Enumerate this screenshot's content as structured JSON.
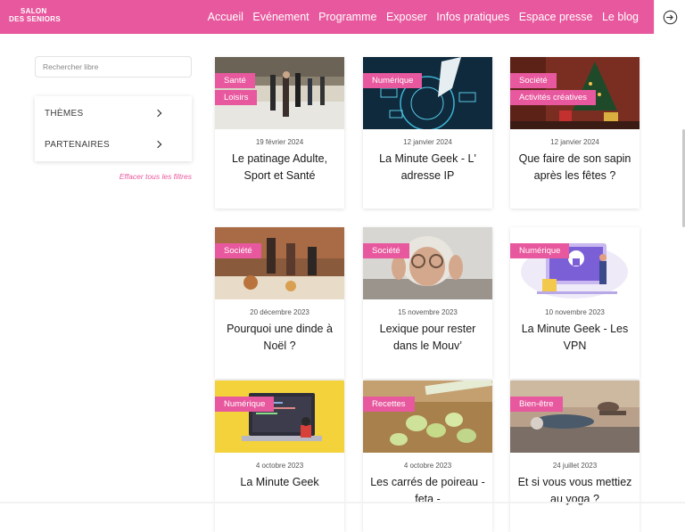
{
  "header": {
    "logo_line1": "SALON",
    "logo_line2": "DES SENIORS",
    "nav": [
      "Accueil",
      "Evénement",
      "Programme",
      "Exposer",
      "Infos pratiques",
      "Espace presse",
      "Le blog"
    ],
    "login_icon": "login-arrow-icon"
  },
  "sidebar": {
    "search_placeholder": "Rechercher libre",
    "filters": [
      "THÈMES",
      "PARTENAIRES"
    ],
    "clear_label": "Effacer tous les filtres"
  },
  "cards": [
    {
      "tags": [
        "Santé",
        "Loisirs"
      ],
      "date": "19 février 2024",
      "title": "Le patinage Adulte, Sport et Santé"
    },
    {
      "tags": [
        "Numérique"
      ],
      "date": "12 janvier 2024",
      "title": "La Minute Geek - L' adresse IP"
    },
    {
      "tags": [
        "Société",
        "Activités créatives"
      ],
      "date": "12 janvier 2024",
      "title": "Que faire de son sapin après les fêtes ?"
    },
    {
      "tags": [
        "Société"
      ],
      "date": "20 décembre 2023",
      "title": "Pourquoi une dinde à Noël ?"
    },
    {
      "tags": [
        "Société"
      ],
      "date": "15 novembre 2023",
      "title": "Lexique pour rester dans le Mouv’"
    },
    {
      "tags": [
        "Numérique"
      ],
      "date": "10 novembre 2023",
      "title": "La Minute Geek - Les VPN"
    },
    {
      "tags": [
        "Numérique"
      ],
      "date": "4 octobre 2023",
      "title": "La Minute Geek"
    },
    {
      "tags": [
        "Recettes"
      ],
      "date": "4 octobre 2023",
      "title": "Les carrés de poireau - feta -"
    },
    {
      "tags": [
        "Bien-être"
      ],
      "date": "24 juillet 2023",
      "title": "Et si vous vous mettiez au yoga ?"
    }
  ],
  "colors": {
    "accent": "#e8589e"
  }
}
